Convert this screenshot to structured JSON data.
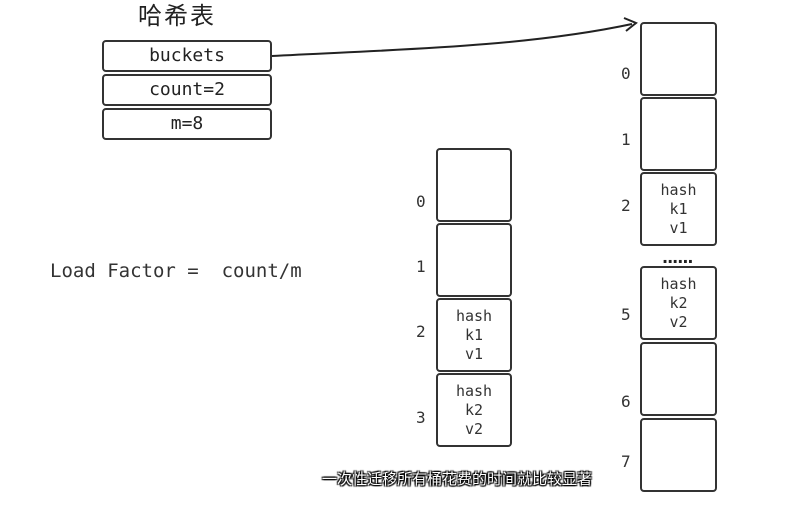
{
  "title": "哈希表",
  "struct_fields": [
    "buckets",
    "count=2",
    "m=8"
  ],
  "formula": "Load Factor =  count/m",
  "small_table": {
    "indices": [
      "0",
      "1",
      "2",
      "3"
    ],
    "cells": [
      [],
      [],
      [
        "hash",
        "k1",
        "v1"
      ],
      [
        "hash",
        "k2",
        "v2"
      ]
    ]
  },
  "large_table": {
    "indices": [
      "0",
      "1",
      "2",
      "5",
      "6",
      "7"
    ],
    "cells": [
      [],
      [],
      [
        "hash",
        "k1",
        "v1"
      ],
      [
        "hash",
        "k2",
        "v2"
      ],
      [],
      []
    ],
    "ellipsis": "......"
  },
  "subtitle": "一次性迁移所有桶花费的时间就比较显著"
}
